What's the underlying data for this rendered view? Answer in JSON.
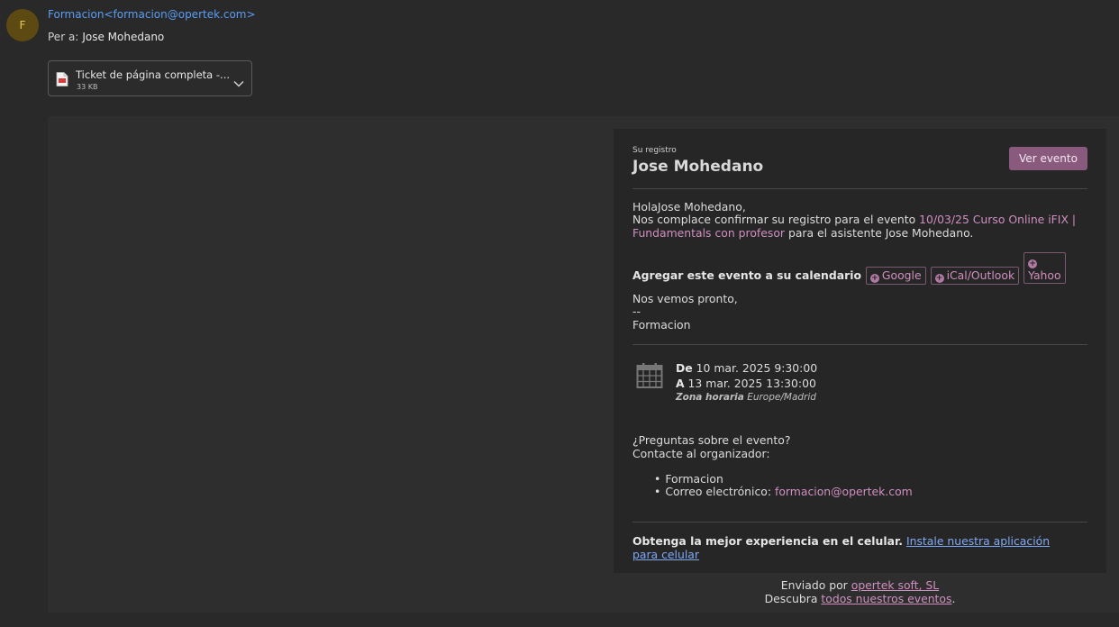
{
  "header": {
    "avatar_letter": "F",
    "sender": "Formacion<formacion@opertek.com>",
    "to_label": "Per a:",
    "to_name": "Jose Mohedano"
  },
  "attachment": {
    "name": "Ticket de página completa -...",
    "size": "33 KB",
    "icon": "pdf-file-icon"
  },
  "card": {
    "registration_label": "Su registro",
    "registrant_name": "Jose Mohedano",
    "view_event_button": "Ver evento",
    "greeting": "HolaJose Mohedano,",
    "confirm_prefix": "Nos complace confirmar su registro para el evento",
    "event_link_line1": "10/03/25 Curso Online iFIX |",
    "event_link_line2": "Fundamentals con profesor",
    "confirm_suffix": "para el asistente Jose Mohedano.",
    "add_calendar_label": "Agregar este evento a su calendario",
    "calendar_buttons": [
      "Google",
      "iCal/Outlook",
      "Yahoo"
    ],
    "see_you": "Nos vemos pronto,",
    "sig_dash": "--",
    "sig_name": "Formacion",
    "from_label": "De",
    "from_date": "10 mar. 2025 9:30:00",
    "to_label": "A",
    "to_date": "13 mar. 2025 13:30:00",
    "tz_label": "Zona horaria",
    "tz_value": "Europe/Madrid",
    "questions": "¿Preguntas sobre el evento?",
    "contact": "Contacte al organizador:",
    "organizer_name": "Formacion",
    "email_label": "Correo electrónico:",
    "email_value": "formacion@opertek.com",
    "mobile_bold": "Obtenga la mejor experiencia en el celular.",
    "mobile_link_line1": "Instale nuestra aplicación",
    "mobile_link_line2": "para celular"
  },
  "footer": {
    "sent_by": "Enviado por",
    "company_link": "opertek soft, SL",
    "discover": "Descubra",
    "events_link": "todos nuestros eventos",
    "period": "."
  },
  "colors": {
    "background": "#292929",
    "card": "#262626",
    "accent": "#8a5a7e",
    "link": "#d08fc0",
    "sender": "#5b9df5"
  }
}
